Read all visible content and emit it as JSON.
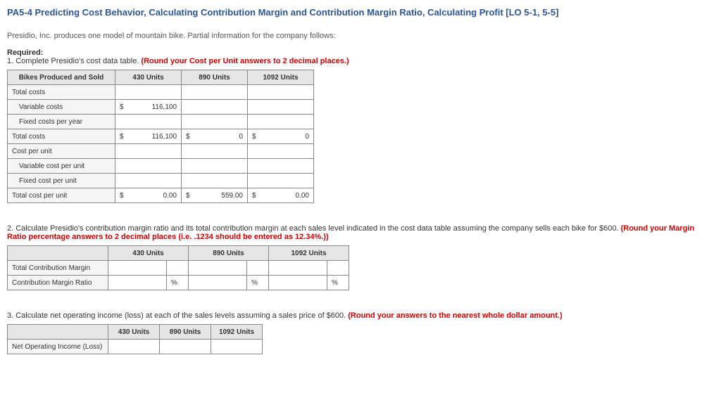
{
  "title": "PA5-4 Predicting Cost Behavior, Calculating Contribution Margin and Contribution Margin Ratio, Calculating Profit [LO 5-1, 5-5]",
  "intro": "Presidio, Inc. produces one model of mountain bike. Partial information for the company follows:",
  "required_label": "Required:",
  "q1": {
    "text": "1. Complete Presidio's cost data table. ",
    "red": "(Round your Cost per Unit answers to 2 decimal places.)",
    "headers": {
      "c0": "Bikes Produced and Sold",
      "c1": "430 Units",
      "c2": "890 Units",
      "c3": "1092 Units"
    },
    "rows": {
      "total_costs": "Total costs",
      "variable_costs": "Variable costs",
      "fixed_costs_year": "Fixed costs per year",
      "total_costs2": "Total costs",
      "cost_per_unit": "Cost per unit",
      "var_cost_unit": "Variable cost per unit",
      "fixed_cost_unit": "Fixed cost per unit",
      "total_cost_unit": "Total cost per unit"
    },
    "values": {
      "vc_430": "116,100",
      "tc_430": "116,100",
      "tc_890": "0",
      "tc_1092": "0",
      "tcu_430": "0.00",
      "tcu_890": "559.00",
      "tcu_1092": "0.00"
    },
    "currency": "$"
  },
  "q2": {
    "text": "2. Calculate Presidio's contribution margin ratio and its total contribution margin at each sales level indicated in the cost data table assuming the company sells each bike for $600. ",
    "red": "(Round your Margin Ratio percentage answers to 2 decimal places (i.e. .1234 should be entered as 12.34%.))",
    "headers": {
      "c1": "430 Units",
      "c2": "890 Units",
      "c3": "1092 Units"
    },
    "rows": {
      "tcm": "Total Contribution Margin",
      "cmr": "Contribution Margin Ratio"
    },
    "pct": "%"
  },
  "q3": {
    "text": "3. Calculate net operating income (loss) at each of the sales levels assuming a sales price of $600. ",
    "red": "(Round your answers to the nearest whole dollar amount.)",
    "headers": {
      "c1": "430 Units",
      "c2": "890 Units",
      "c3": "1092 Units"
    },
    "rows": {
      "noi": "Net Operating Income (Loss)"
    }
  }
}
